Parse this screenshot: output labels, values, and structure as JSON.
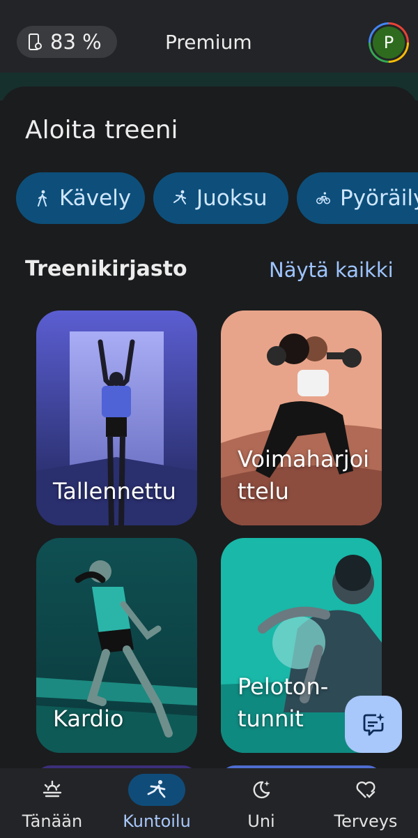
{
  "status": {
    "battery_percent": "83 %",
    "plan_label": "Premium",
    "avatar_initial": "P"
  },
  "start_workout": {
    "title": "Aloita treeni",
    "chips": [
      {
        "label": "Kävely",
        "icon": "walk-icon"
      },
      {
        "label": "Juoksu",
        "icon": "run-icon"
      },
      {
        "label": "Pyöräily",
        "icon": "bike-icon"
      }
    ]
  },
  "library": {
    "title": "Treenikirjasto",
    "see_all_label": "Näytä kaikki",
    "cards": [
      {
        "label": "Tallennettu"
      },
      {
        "label": "Voimaharjoi ttelu"
      },
      {
        "label": "Kardio"
      },
      {
        "label": "Peloton-tunnit"
      }
    ]
  },
  "fab": {
    "icon": "ai-chat-icon"
  },
  "bottom_nav": {
    "items": [
      {
        "label": "Tänään",
        "icon": "sunrise-icon"
      },
      {
        "label": "Kuntoilu",
        "icon": "run-icon",
        "active": true
      },
      {
        "label": "Uni",
        "icon": "moon-icon"
      },
      {
        "label": "Terveys",
        "icon": "heart-check-icon"
      }
    ]
  },
  "colors": {
    "accent": "#a8c7fa",
    "chip_bg": "#0d4f7a",
    "background": "#1b1c1e"
  }
}
